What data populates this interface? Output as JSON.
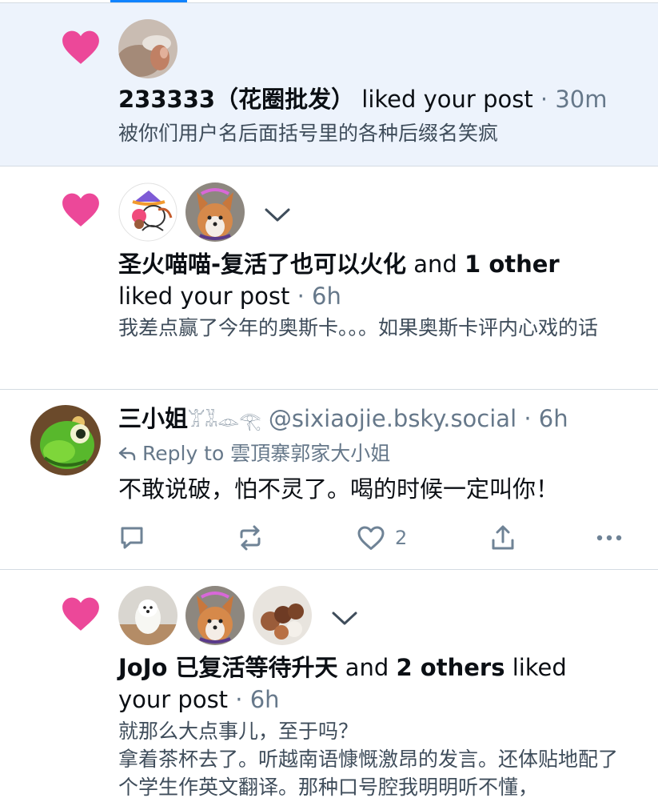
{
  "colors": {
    "accent": "#1083fe",
    "heart": "#ec4899",
    "unread_bg": "#edf3fc",
    "divider": "#d4dbe2",
    "muted_text": "#66788a"
  },
  "notifications": [
    {
      "type": "like",
      "unread": true,
      "avatars": [
        "avatar-flower-photo"
      ],
      "actor": "233333（花圈批发）",
      "action": "liked your post",
      "time": "· 30m",
      "snippet": "被你们用户名后面括号里的各种后缀名笑疯"
    },
    {
      "type": "like",
      "unread": false,
      "avatars": [
        "avatar-unicorn-drawing",
        "avatar-corgi"
      ],
      "actor": "圣火喵喵-复活了也可以火化",
      "and_text": "and",
      "others": "1 other",
      "action": "liked your post",
      "time": "· 6h",
      "snippet": "我差点赢了今年的奥斯卡。。。如果奥斯卡评内心戏的话"
    }
  ],
  "post": {
    "author": "三小姐",
    "author_suffix": "𓀠𓀡𓁼𓂀",
    "handle": "@sixiaojie.bsky.social",
    "time": "· 6h",
    "reply_label": "Reply to 雲頂寨郭家大小姐",
    "text": "不敢说破，怕不灵了。喝的时候一定叫你！",
    "actions": {
      "reply_icon": "reply-icon",
      "repost_icon": "repost-icon",
      "like_icon": "like-icon",
      "like_count": "2",
      "share_icon": "share-icon",
      "more_icon": "more-icon"
    }
  },
  "like_group": {
    "avatars": [
      "avatar-white-dog",
      "avatar-corgi",
      "avatar-poodles"
    ],
    "actor": "JoJo 已复活等待升天",
    "and_text": "and",
    "others": "2 others",
    "action_line1": "liked",
    "action_line2": "your post",
    "time": "· 6h",
    "snippet_lines": [
      "就那么大点事儿，至于吗？",
      "拿着茶杯去了。听越南语慷慨激昂的发言。还体贴地配了个学生作英文翻译。那种口号腔我明明听不懂，"
    ]
  }
}
